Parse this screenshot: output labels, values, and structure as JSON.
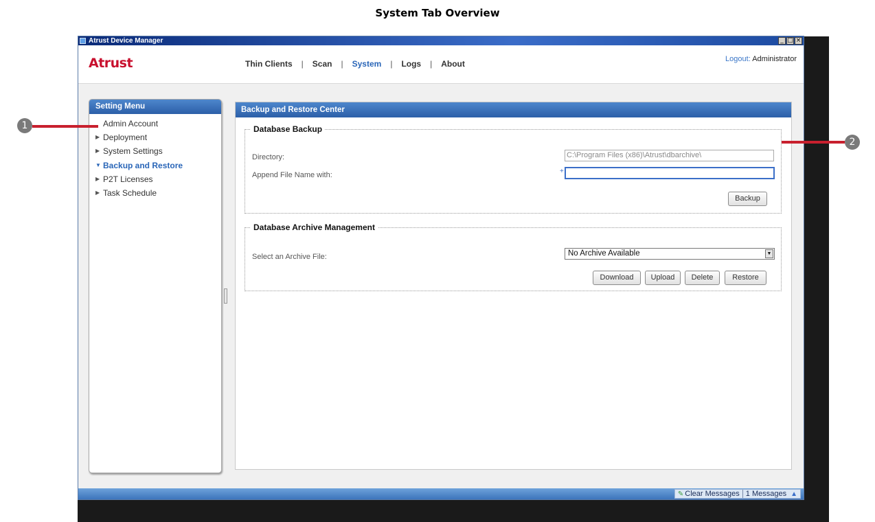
{
  "doc_title": "System Tab Overview",
  "window": {
    "title": "Atrust Device Manager",
    "btn_min": "_",
    "btn_max": "□",
    "btn_close": "×"
  },
  "header": {
    "logo": "Atrust",
    "nav": [
      {
        "label": "Thin Clients"
      },
      {
        "label": "Scan"
      },
      {
        "label": "System",
        "active": true
      },
      {
        "label": "Logs"
      },
      {
        "label": "About"
      }
    ],
    "nav_separator": "|",
    "logout_label": "Logout:",
    "user": "Administrator"
  },
  "sidebar": {
    "title": "Setting Menu",
    "items": [
      {
        "label": "Admin Account"
      },
      {
        "label": "Deployment"
      },
      {
        "label": "System Settings"
      },
      {
        "label": "Backup and Restore",
        "active": true
      },
      {
        "label": "P2T Licenses"
      },
      {
        "label": "Task Schedule"
      }
    ]
  },
  "main": {
    "title": "Backup and Restore Center",
    "backup": {
      "legend": "Database Backup",
      "directory_label": "Directory:",
      "directory_value": "C:\\Program Files (x86)\\Atrust\\dbarchive\\",
      "append_label": "Append File Name with:",
      "append_value": "",
      "backup_button": "Backup"
    },
    "archive": {
      "legend": "Database Archive Management",
      "select_label": "Select an Archive File:",
      "select_value": "No Archive Available",
      "buttons": {
        "download": "Download",
        "upload": "Upload",
        "delete": "Delete",
        "restore": "Restore"
      }
    }
  },
  "statusbar": {
    "clear_messages": "Clear Messages",
    "message_count": "1 Messages"
  },
  "callouts": {
    "one": "1",
    "two": "2"
  },
  "colors": {
    "brand_red": "#c8102e",
    "accent_blue": "#2a66b8",
    "callout_line": "#c8202e"
  }
}
